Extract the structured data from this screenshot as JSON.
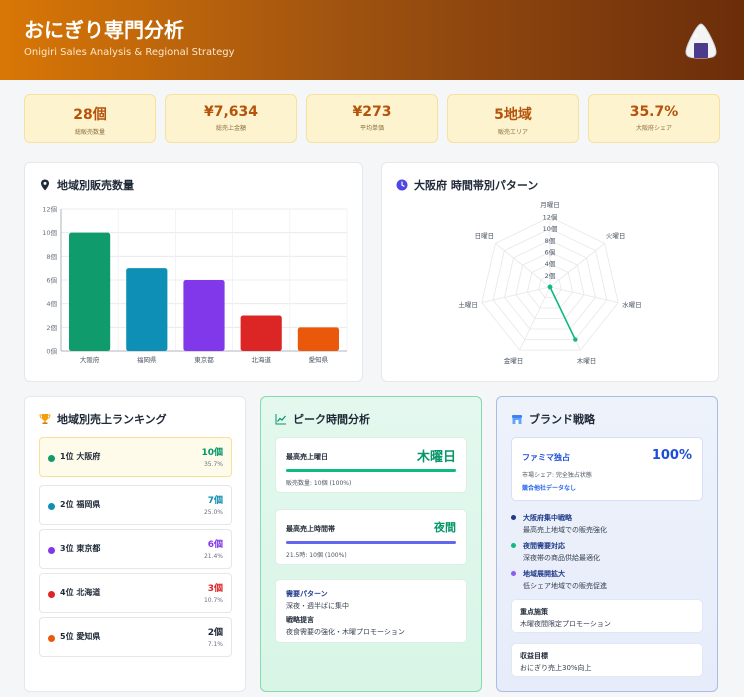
{
  "header": {
    "title": "おにぎり専門分析",
    "subtitle": "Onigiri Sales Analysis & Regional Strategy",
    "logo_icon": "onigiri-icon"
  },
  "kpis": [
    {
      "value": "28個",
      "label": "総販売数量"
    },
    {
      "value": "¥7,634",
      "label": "総売上金額"
    },
    {
      "value": "¥273",
      "label": "平均単価"
    },
    {
      "value": "5地域",
      "label": "販売エリア"
    },
    {
      "value": "35.7%",
      "label": "大阪府シェア"
    }
  ],
  "region_chart": {
    "title": "地域別販売数量",
    "icon": "map-pin-icon"
  },
  "radar_chart": {
    "title": "大阪府 時間帯別パターン",
    "icon": "clock-icon"
  },
  "chart_data": [
    {
      "type": "bar",
      "title": "地域別販売数量",
      "categories": [
        "大阪府",
        "福岡県",
        "東京都",
        "北海道",
        "愛知県"
      ],
      "values": [
        10,
        7,
        6,
        3,
        2
      ],
      "colors": [
        "#109b6c",
        "#0e8fb6",
        "#8137ea",
        "#dc2626",
        "#ea580c"
      ],
      "ylim": [
        0,
        12
      ],
      "yticks": [
        "0個",
        "2個",
        "4個",
        "6個",
        "8個",
        "10個",
        "12個"
      ],
      "grid": true
    },
    {
      "type": "radar",
      "title": "大阪府 時間帯別パターン",
      "axes": [
        "月曜日",
        "火曜日",
        "水曜日",
        "木曜日",
        "金曜日",
        "土曜日",
        "日曜日"
      ],
      "values": [
        0,
        0,
        0,
        10,
        0,
        0,
        0
      ],
      "rlim": [
        0,
        12
      ],
      "rticks": [
        "2個",
        "4個",
        "6個",
        "8個",
        "10個",
        "12個"
      ],
      "color": "#10b981"
    }
  ],
  "ranking": {
    "title": "地域別売上ランキング",
    "icon": "trophy-icon",
    "items": [
      {
        "name": "1位 大阪府",
        "count": "10個",
        "pct": "35.7%",
        "color": "#109b6c"
      },
      {
        "name": "2位 福岡県",
        "count": "7個",
        "pct": "25.0%",
        "color": "#0e8fb6"
      },
      {
        "name": "3位 東京都",
        "count": "6個",
        "pct": "21.4%",
        "color": "#8137ea"
      },
      {
        "name": "4位 北海道",
        "count": "3個",
        "pct": "10.7%",
        "color": "#dc2626"
      },
      {
        "name": "5位 愛知県",
        "count": "2個",
        "pct": "7.1%",
        "color": "#ea580c"
      }
    ]
  },
  "peak": {
    "title": "ピーク時間分析",
    "icon": "trend-icon",
    "day_label": "最高売上曜日",
    "day_value": "木曜日",
    "day_note": "販売数量: 10個 (100%)",
    "time_label": "最高売上時間帯",
    "time_value": "夜間",
    "time_note": "21.5時: 10個 (100%)",
    "pattern_label": "需要パターン",
    "pattern_text": "深夜・週半ばに集中",
    "strategy_label": "戦略提言",
    "strategy_text": "夜食需要の強化・木曜プロモーション"
  },
  "brand": {
    "title": "ブランド戦略",
    "icon": "store-icon",
    "top_name": "ファミマ独占",
    "top_value": "100%",
    "top_note": "市場シェア: 完全独占状態",
    "top_link": "競合他社データなし",
    "items": [
      {
        "title": "大阪府集中戦略",
        "desc": "最高売上地域での販売強化",
        "color": "#1e3a8a"
      },
      {
        "title": "夜間需要対応",
        "desc": "深夜帯の商品供給最適化",
        "color": "#10b981"
      },
      {
        "title": "地域展開拡大",
        "desc": "低シェア地域での販売促進",
        "color": "#8b5cf6"
      }
    ],
    "focus_label": "重点施策",
    "focus_text": "木曜夜間限定プロモーション",
    "goal_label": "収益目標",
    "goal_text": "おにぎり売上30%向上"
  }
}
